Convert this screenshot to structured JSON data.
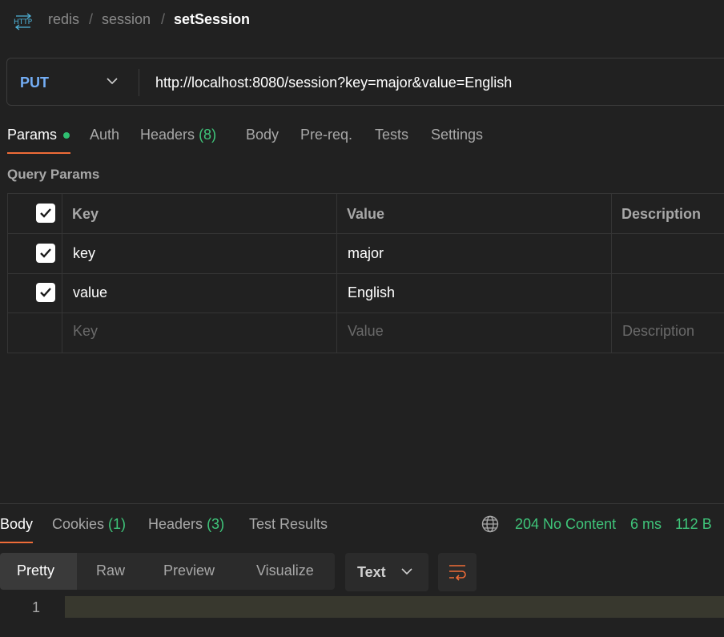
{
  "breadcrumb": {
    "icon": "http-icon",
    "items": [
      "redis",
      "session"
    ],
    "current": "setSession"
  },
  "request": {
    "method": "PUT",
    "url": "http://localhost:8080/session?key=major&value=English"
  },
  "request_tabs": {
    "params": "Params",
    "auth": "Auth",
    "headers": "Headers",
    "headers_count": "(8)",
    "body": "Body",
    "prereq": "Pre-req.",
    "tests": "Tests",
    "settings": "Settings"
  },
  "query_params": {
    "title": "Query Params",
    "columns": [
      "Key",
      "Value",
      "Description"
    ],
    "rows": [
      {
        "key": "key",
        "value": "major",
        "checked": true
      },
      {
        "key": "value",
        "value": "English",
        "checked": true
      }
    ],
    "placeholders": {
      "key": "Key",
      "value": "Value",
      "description": "Description"
    }
  },
  "response_tabs": {
    "body": "Body",
    "cookies": "Cookies",
    "cookies_count": "(1)",
    "headers": "Headers",
    "headers_count": "(3)",
    "test_results": "Test Results"
  },
  "response_meta": {
    "status": "204 No Content",
    "time": "6 ms",
    "size": "112 B"
  },
  "body_view": {
    "modes": [
      "Pretty",
      "Raw",
      "Preview",
      "Visualize"
    ],
    "format": "Text",
    "line_numbers": [
      "1"
    ]
  },
  "colors": {
    "accent": "#ef6c38",
    "method": "#74aef6",
    "success": "#3fc57a"
  }
}
